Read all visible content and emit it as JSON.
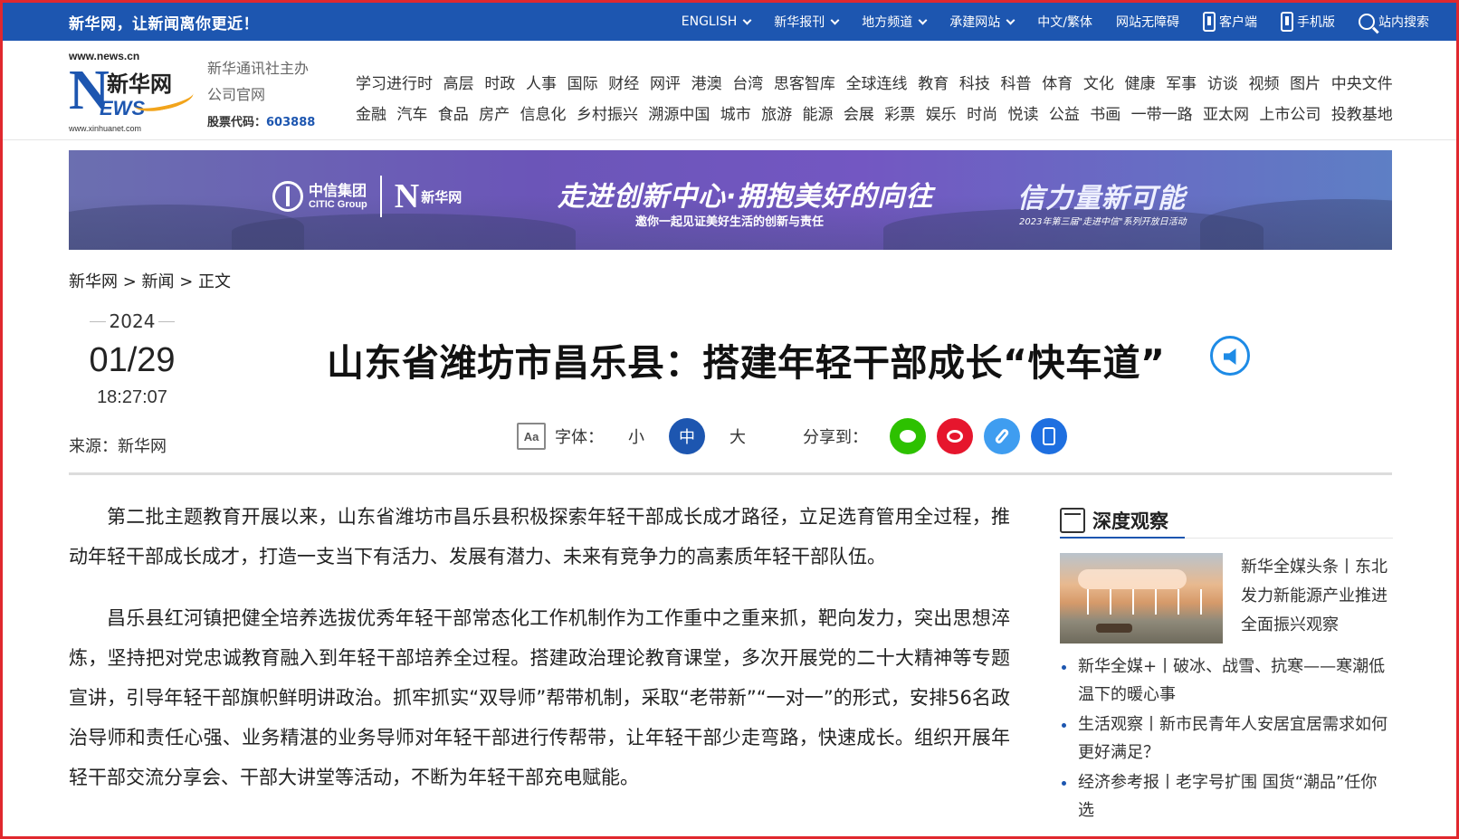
{
  "topbar": {
    "slogan": "新华网，让新闻离你更近！",
    "nav": [
      {
        "label": "ENGLISH",
        "dropdown": true
      },
      {
        "label": "新华报刊",
        "dropdown": true
      },
      {
        "label": "地方频道",
        "dropdown": true
      },
      {
        "label": "承建网站",
        "dropdown": true
      },
      {
        "label": "中文/繁体",
        "dropdown": false
      },
      {
        "label": "网站无障碍",
        "dropdown": false
      },
      {
        "label": "客户端",
        "icon": "phone-icon"
      },
      {
        "label": "手机版",
        "icon": "phone-icon"
      },
      {
        "label": "站内搜索",
        "icon": "search-icon"
      }
    ]
  },
  "header": {
    "logo": {
      "url_top": "www.news.cn",
      "name_cn": "新华网",
      "url_bottom": "www.xinhuanet.com"
    },
    "sponsor_line1": "新华通讯社主办",
    "sponsor_line2": "公司官网",
    "stock_label": "股票代码：",
    "stock_code": "603888",
    "channels_row1": [
      "学习进行时",
      "高层",
      "时政",
      "人事",
      "国际",
      "财经",
      "网评",
      "港澳",
      "台湾",
      "思客智库",
      "全球连线",
      "教育",
      "科技",
      "科普",
      "体育",
      "文化",
      "健康",
      "军事",
      "访谈",
      "视频",
      "图片",
      "中央文件"
    ],
    "channels_row2": [
      "金融",
      "汽车",
      "食品",
      "房产",
      "信息化",
      "乡村振兴",
      "溯源中国",
      "城市",
      "旅游",
      "能源",
      "会展",
      "彩票",
      "娱乐",
      "时尚",
      "悦读",
      "公益",
      "书画",
      "一带一路",
      "亚太网",
      "上市公司",
      "投教基地"
    ]
  },
  "banner": {
    "citic_cn": "中信集团",
    "citic_en": "CITIC Group",
    "xh_n": "N",
    "xh_cn": "新华网",
    "slogan_main": "走进创新中心·拥抱美好的向往",
    "slogan_sub": "邀你一起见证美好生活的创新与责任",
    "slogan_right": "信力量新可能",
    "slogan_right_sub": "2023年第三届\"走进中信\"系列开放日活动"
  },
  "breadcrumb": "新华网 > 新闻 > 正文",
  "date": {
    "year": "2024",
    "month_day": "01/29",
    "time": "18:27:07"
  },
  "source": "来源：新华网",
  "title": "山东省潍坊市昌乐县：搭建年轻干部成长“快车道”",
  "tools": {
    "font_label": "字体：",
    "sizes": [
      "小",
      "中",
      "大"
    ],
    "active_size": "中",
    "share_label": "分享到："
  },
  "article": {
    "paragraphs": [
      "第二批主题教育开展以来，山东省潍坊市昌乐县积极探索年轻干部成长成才路径，立足选育管用全过程，推动年轻干部成长成才，打造一支当下有活力、发展有潜力、未来有竞争力的高素质年轻干部队伍。",
      "昌乐县红河镇把健全培养选拔优秀年轻干部常态化工作机制作为工作重中之重来抓，靶向发力，突出思想淬炼，坚持把对党忠诚教育融入到年轻干部培养全过程。搭建政治理论教育课堂，多次开展党的二十大精神等专题宣讲，引导年轻干部旗帜鲜明讲政治。抓牢抓实“双导师”帮带机制，采取“老带新”“一对一”的形式，安排56名政治导师和责任心强、业务精湛的业务导师对年轻干部进行传帮带，让年轻干部少走弯路，快速成长。组织开展年轻干部交流分享会、干部大讲堂等活动，不断为年轻干部充电赋能。"
    ]
  },
  "sidebar": {
    "title": "深度观察",
    "feature_text": "新华全媒头条丨东北发力新能源产业推进全面振兴观察",
    "items": [
      "新华全媒+丨破冰、战雪、抗寒——寒潮低温下的暖心事",
      "生活观察丨新市民青年人安居宜居需求如何更好满足？",
      "经济参考报丨老字号扩围 国货“潮品”任你选"
    ]
  },
  "colors": {
    "brand_blue": "#1d56b0",
    "border_red": "#e0282e"
  }
}
